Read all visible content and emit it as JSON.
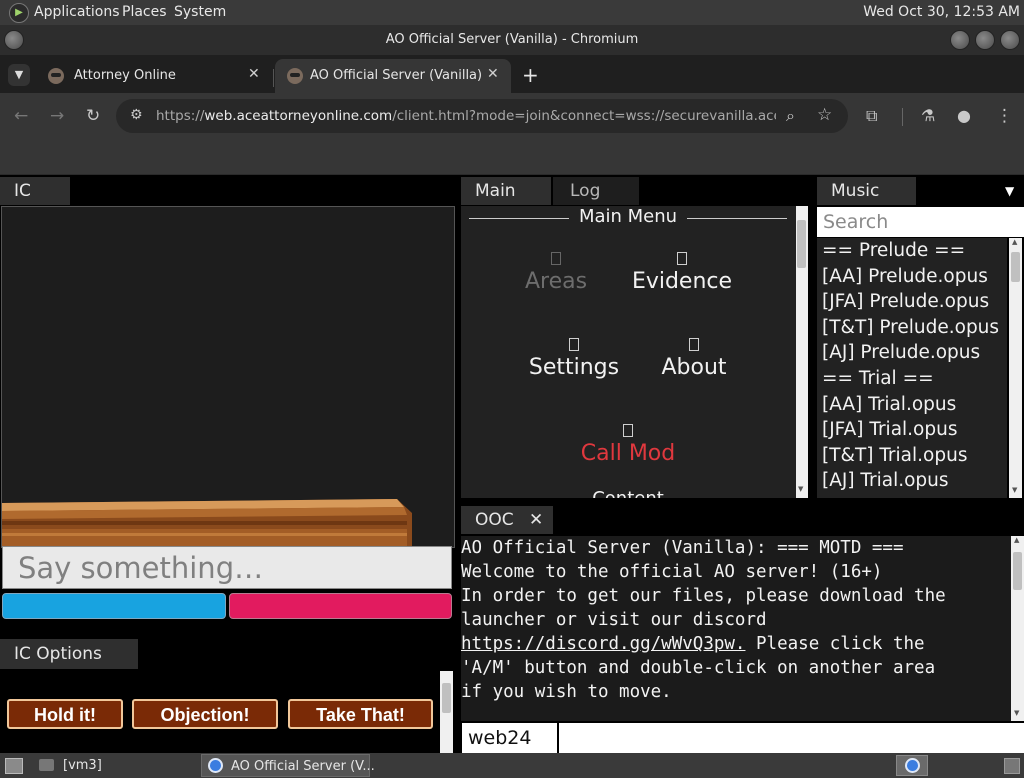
{
  "desktop_panel": {
    "menus": [
      "Applications",
      "Places",
      "System"
    ],
    "clock": "Wed Oct 30, 12:53 AM"
  },
  "window": {
    "title": "AO Official Server (Vanilla) - Chromium"
  },
  "browser": {
    "tabs": [
      {
        "title": "Attorney Online",
        "active": false
      },
      {
        "title": "AO Official Server (Vanilla)",
        "active": true
      }
    ],
    "url_scheme": "https://",
    "url_host": "web.aceattorneyonline.com",
    "url_rest": "/client.html?mode=join&connect=wss://securevanilla.aceattor..."
  },
  "ic": {
    "tab": "IC",
    "input_placeholder": "Say something…",
    "options_tab": "IC Options",
    "shouts": [
      "Hold it!",
      "Objection!",
      "Take That!"
    ]
  },
  "main_panel": {
    "tabs": [
      "Main",
      "Log"
    ],
    "menu_title": "Main Menu",
    "items": [
      {
        "label": "Areas",
        "disabled": true
      },
      {
        "label": "Evidence",
        "disabled": false
      },
      {
        "label": "Settings",
        "disabled": false
      },
      {
        "label": "About",
        "disabled": false
      },
      {
        "label": "Call Mod",
        "disabled": false,
        "color": "#e0383e"
      },
      {
        "label": "Content",
        "disabled": false
      }
    ]
  },
  "music": {
    "tab": "Music",
    "search_placeholder": "Search",
    "items": [
      "== Prelude ==",
      "[AA] Prelude.opus",
      "[JFA] Prelude.opus",
      "[T&T] Prelude.opus",
      "[AJ] Prelude.opus",
      "== Trial ==",
      "[AA] Trial.opus",
      "[JFA] Trial.opus",
      "[T&T] Trial.opus",
      "[AJ] Trial.opus"
    ]
  },
  "ooc": {
    "tab": "OOC",
    "lines": [
      "AO Official Server (Vanilla): === MOTD ===",
      "Welcome to the official AO server! (16+)",
      "In order to get our files, please download the",
      "launcher or visit our discord"
    ],
    "link": "https://discord.gg/wWvQ3pw.",
    "line_after_link": " Please click the",
    "lines_end": [
      "'A/M' button and double-click on another area",
      "if you wish to move."
    ],
    "name_value": "web24"
  },
  "taskbar": {
    "workspace": "[vm3]",
    "task": "AO Official Server (V..."
  },
  "colors": {
    "hp_defense": "#18a3e0",
    "hp_prosecution": "#e21b5f",
    "shout_bg": "#7a2a06",
    "call_mod": "#e0383e"
  }
}
